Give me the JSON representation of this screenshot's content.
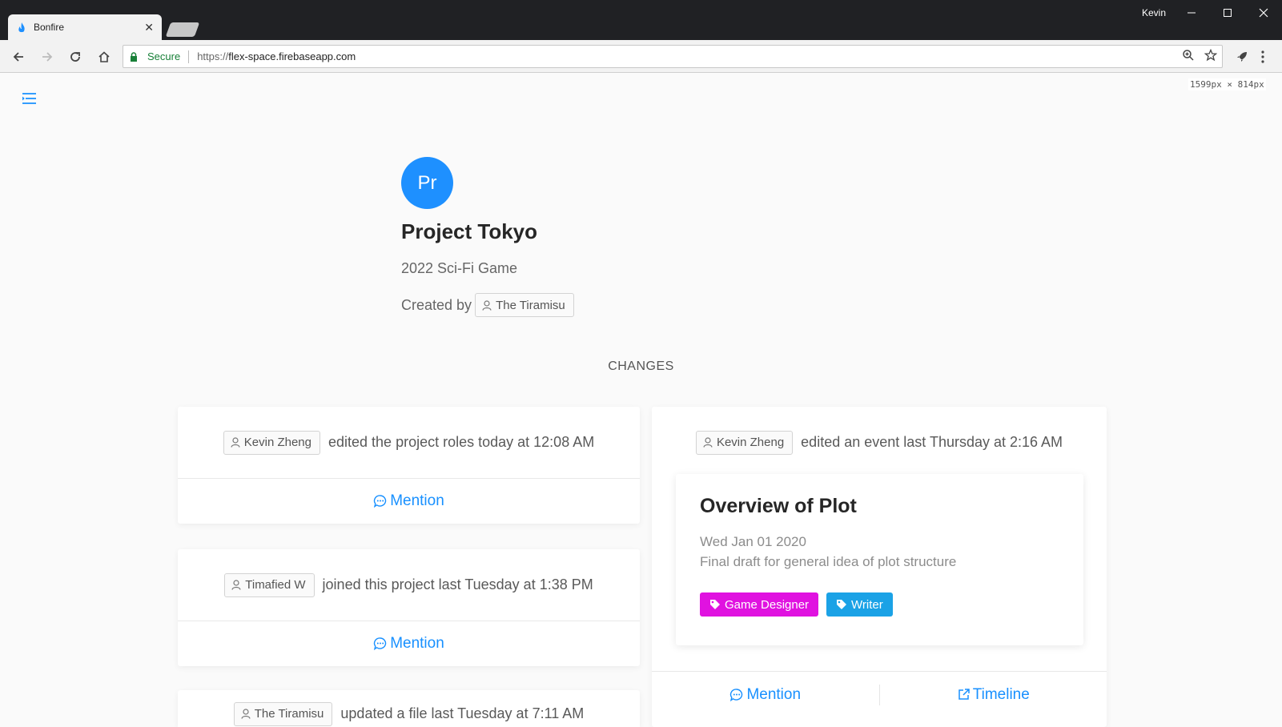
{
  "browser": {
    "tab_title": "Bonfire",
    "user": "Kevin",
    "secure_label": "Secure",
    "url_protocol": "https://",
    "url_host": "flex-space.firebaseapp.com",
    "viewport_readout": "1599px × 814px"
  },
  "project": {
    "avatar_initials": "Pr",
    "title": "Project Tokyo",
    "subtitle": "2022 Sci-Fi Game",
    "created_by_label": "Created by",
    "creator": "The Tiramisu"
  },
  "changes": {
    "heading": "CHANGES",
    "items": [
      {
        "user": "Kevin Zheng",
        "text": "edited the project roles today at 12:08 AM",
        "mention_label": "Mention"
      },
      {
        "user": "Timafied W",
        "text": "joined this project last Tuesday at 1:38 PM",
        "mention_label": "Mention"
      },
      {
        "user": "The Tiramisu",
        "text": "updated a file last Tuesday at 7:11 AM"
      },
      {
        "user": "Kevin Zheng",
        "text": "edited an event last Thursday at 2:16 AM",
        "mention_label": "Mention",
        "timeline_label": "Timeline",
        "event": {
          "title": "Overview of Plot",
          "date": "Wed Jan 01 2020",
          "description": "Final draft for general idea of plot structure",
          "roles": [
            {
              "label": "Game Designer",
              "color": "#e012e0"
            },
            {
              "label": "Writer",
              "color": "#1ba2e6"
            }
          ]
        }
      }
    ]
  },
  "colors": {
    "accent": "#1890ff",
    "avatar": "#1e90ff"
  }
}
